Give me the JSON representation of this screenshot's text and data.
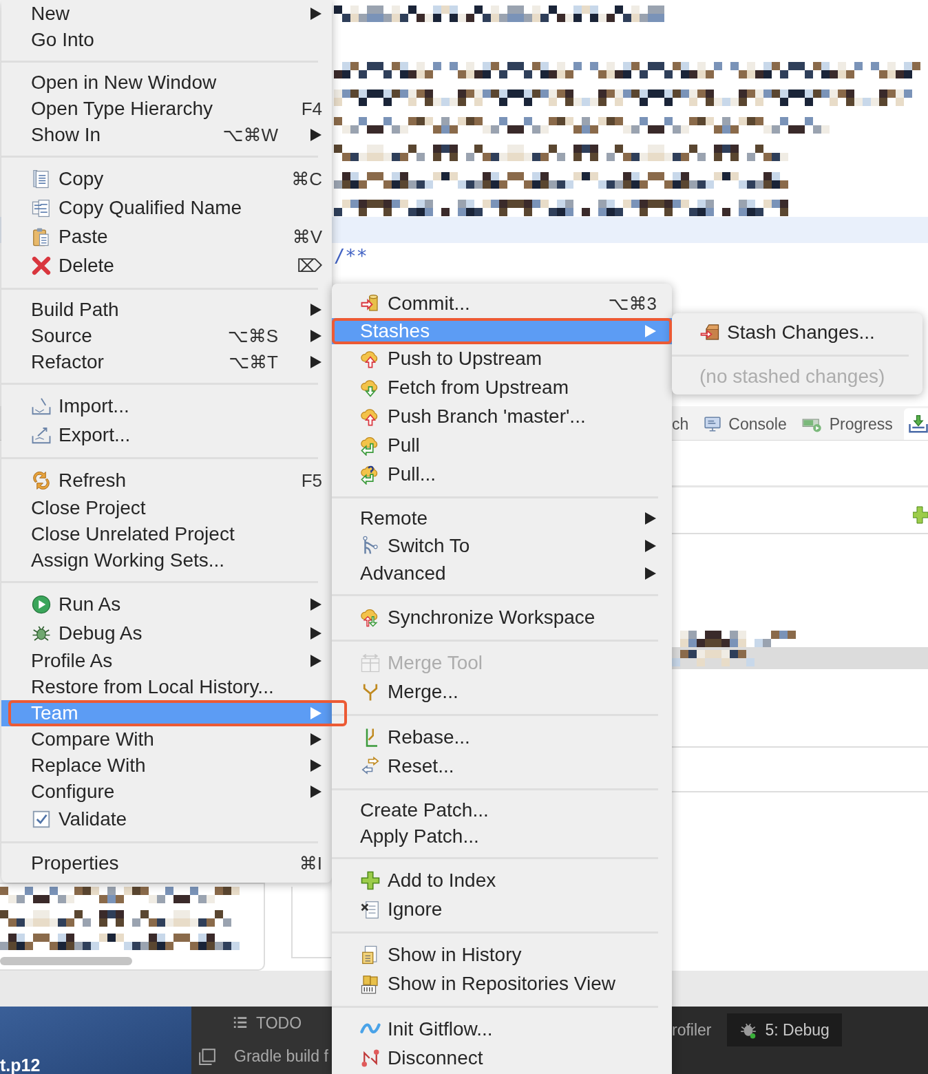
{
  "editor": {
    "comment_line": "/**"
  },
  "view_tabs": [
    {
      "label": "ch",
      "selected": false
    },
    {
      "label": "Console",
      "selected": false
    },
    {
      "label": "Progress",
      "selected": false
    },
    {
      "selected": true
    }
  ],
  "tool_windows": [
    {
      "label": "TODO",
      "selected": false
    },
    {
      "label": "Gradle build f",
      "selected": false
    },
    {
      "label": "rofiler",
      "selected": false
    },
    {
      "label": "5: Debug",
      "selected": true
    }
  ],
  "desktop": {
    "file_label": "t.p12"
  },
  "context_menu": {
    "items": [
      {
        "kind": "item",
        "label": "New",
        "submenu": true,
        "selected": false,
        "disabled": false
      },
      {
        "kind": "item",
        "label": "Go Into",
        "submenu": false,
        "selected": false,
        "disabled": false
      },
      {
        "kind": "separator"
      },
      {
        "kind": "item",
        "label": "Open in New Window",
        "submenu": false,
        "selected": false,
        "disabled": false
      },
      {
        "kind": "item",
        "label": "Open Type Hierarchy",
        "shortcut": "F4",
        "submenu": false,
        "selected": false,
        "disabled": false
      },
      {
        "kind": "item",
        "label": "Show In",
        "shortcut": "⌥⌘W",
        "submenu": true,
        "selected": false,
        "disabled": false
      },
      {
        "kind": "separator"
      },
      {
        "kind": "item",
        "label": "Copy",
        "shortcut": "⌘C",
        "submenu": false,
        "selected": false,
        "disabled": false
      },
      {
        "kind": "item",
        "label": "Copy Qualified Name",
        "submenu": false,
        "selected": false,
        "disabled": false
      },
      {
        "kind": "item",
        "label": "Paste",
        "shortcut": "⌘V",
        "submenu": false,
        "selected": false,
        "disabled": false
      },
      {
        "kind": "item",
        "label": "Delete",
        "shortcut": "⌦",
        "submenu": false,
        "selected": false,
        "disabled": false
      },
      {
        "kind": "separator"
      },
      {
        "kind": "item",
        "label": "Build Path",
        "submenu": true,
        "selected": false,
        "disabled": false
      },
      {
        "kind": "item",
        "label": "Source",
        "shortcut": "⌥⌘S",
        "submenu": true,
        "selected": false,
        "disabled": false
      },
      {
        "kind": "item",
        "label": "Refactor",
        "shortcut": "⌥⌘T",
        "submenu": true,
        "selected": false,
        "disabled": false
      },
      {
        "kind": "separator"
      },
      {
        "kind": "item",
        "label": "Import...",
        "submenu": false,
        "selected": false,
        "disabled": false
      },
      {
        "kind": "item",
        "label": "Export...",
        "submenu": false,
        "selected": false,
        "disabled": false
      },
      {
        "kind": "separator"
      },
      {
        "kind": "item",
        "label": "Refresh",
        "shortcut": "F5",
        "submenu": false,
        "selected": false,
        "disabled": false
      },
      {
        "kind": "item",
        "label": "Close Project",
        "submenu": false,
        "selected": false,
        "disabled": false
      },
      {
        "kind": "item",
        "label": "Close Unrelated Project",
        "submenu": false,
        "selected": false,
        "disabled": false
      },
      {
        "kind": "item",
        "label": "Assign Working Sets...",
        "submenu": false,
        "selected": false,
        "disabled": false
      },
      {
        "kind": "separator"
      },
      {
        "kind": "item",
        "label": "Run As",
        "submenu": true,
        "selected": false,
        "disabled": false
      },
      {
        "kind": "item",
        "label": "Debug As",
        "submenu": true,
        "selected": false,
        "disabled": false
      },
      {
        "kind": "item",
        "label": "Profile As",
        "submenu": true,
        "selected": false,
        "disabled": false
      },
      {
        "kind": "item",
        "label": "Restore from Local History...",
        "submenu": false,
        "selected": false,
        "disabled": false
      },
      {
        "kind": "item",
        "label": "Team",
        "submenu": true,
        "selected": true,
        "disabled": false
      },
      {
        "kind": "item",
        "label": "Compare With",
        "submenu": true,
        "selected": false,
        "disabled": false
      },
      {
        "kind": "item",
        "label": "Replace With",
        "submenu": true,
        "selected": false,
        "disabled": false
      },
      {
        "kind": "item",
        "label": "Configure",
        "submenu": true,
        "selected": false,
        "disabled": false
      },
      {
        "kind": "item",
        "label": "Validate",
        "submenu": false,
        "selected": false,
        "disabled": false
      },
      {
        "kind": "separator"
      },
      {
        "kind": "item",
        "label": "Properties",
        "shortcut": "⌘I",
        "submenu": false,
        "selected": false,
        "disabled": false
      }
    ]
  },
  "team_menu": {
    "items": [
      {
        "kind": "item",
        "label": "Commit...",
        "shortcut": "⌥⌘3",
        "submenu": false,
        "selected": false,
        "disabled": false
      },
      {
        "kind": "item",
        "label": "Stashes",
        "submenu": true,
        "selected": true,
        "disabled": false
      },
      {
        "kind": "item",
        "label": "Push to Upstream",
        "submenu": false,
        "selected": false,
        "disabled": false
      },
      {
        "kind": "item",
        "label": "Fetch from Upstream",
        "submenu": false,
        "selected": false,
        "disabled": false
      },
      {
        "kind": "item",
        "label": "Push Branch 'master'...",
        "submenu": false,
        "selected": false,
        "disabled": false
      },
      {
        "kind": "item",
        "label": "Pull",
        "submenu": false,
        "selected": false,
        "disabled": false
      },
      {
        "kind": "item",
        "label": "Pull...",
        "submenu": false,
        "selected": false,
        "disabled": false
      },
      {
        "kind": "separator"
      },
      {
        "kind": "item",
        "label": "Remote",
        "submenu": true,
        "selected": false,
        "disabled": false
      },
      {
        "kind": "item",
        "label": "Switch To",
        "submenu": true,
        "selected": false,
        "disabled": false
      },
      {
        "kind": "item",
        "label": "Advanced",
        "submenu": true,
        "selected": false,
        "disabled": false
      },
      {
        "kind": "separator"
      },
      {
        "kind": "item",
        "label": "Synchronize Workspace",
        "submenu": false,
        "selected": false,
        "disabled": false
      },
      {
        "kind": "separator"
      },
      {
        "kind": "item",
        "label": "Merge Tool",
        "submenu": false,
        "selected": false,
        "disabled": true
      },
      {
        "kind": "item",
        "label": "Merge...",
        "submenu": false,
        "selected": false,
        "disabled": false
      },
      {
        "kind": "separator"
      },
      {
        "kind": "item",
        "label": "Rebase...",
        "submenu": false,
        "selected": false,
        "disabled": false
      },
      {
        "kind": "item",
        "label": "Reset...",
        "submenu": false,
        "selected": false,
        "disabled": false
      },
      {
        "kind": "separator"
      },
      {
        "kind": "item",
        "label": "Create Patch...",
        "submenu": false,
        "selected": false,
        "disabled": false
      },
      {
        "kind": "item",
        "label": "Apply Patch...",
        "submenu": false,
        "selected": false,
        "disabled": false
      },
      {
        "kind": "separator"
      },
      {
        "kind": "item",
        "label": "Add to Index",
        "submenu": false,
        "selected": false,
        "disabled": false
      },
      {
        "kind": "item",
        "label": "Ignore",
        "submenu": false,
        "selected": false,
        "disabled": false
      },
      {
        "kind": "separator"
      },
      {
        "kind": "item",
        "label": "Show in History",
        "submenu": false,
        "selected": false,
        "disabled": false
      },
      {
        "kind": "item",
        "label": "Show in Repositories View",
        "submenu": false,
        "selected": false,
        "disabled": false
      },
      {
        "kind": "separator"
      },
      {
        "kind": "item",
        "label": "Init Gitflow...",
        "submenu": false,
        "selected": false,
        "disabled": false
      },
      {
        "kind": "item",
        "label": "Disconnect",
        "submenu": false,
        "selected": false,
        "disabled": false
      }
    ]
  },
  "stashes_menu": {
    "items": [
      {
        "kind": "item",
        "label": "Stash Changes...",
        "submenu": false,
        "selected": false,
        "disabled": false
      },
      {
        "kind": "separator"
      },
      {
        "kind": "item",
        "label": "(no stashed changes)",
        "submenu": false,
        "selected": false,
        "disabled": true
      }
    ]
  }
}
